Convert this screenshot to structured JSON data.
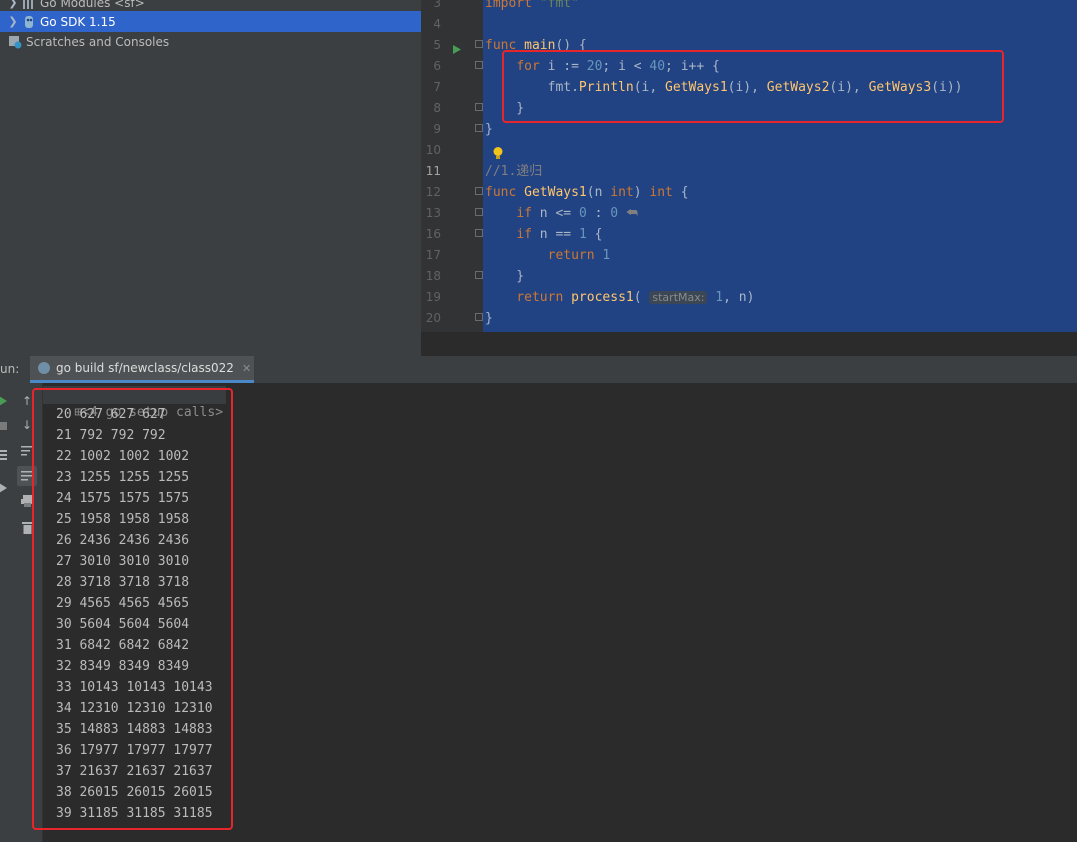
{
  "project_tree": {
    "items": [
      {
        "label": "Go Modules <sf>",
        "icon": "library-icon"
      },
      {
        "label": "Go SDK 1.15",
        "icon": "go-sdk-icon"
      },
      {
        "label": "Scratches and Consoles",
        "icon": "scratches-icon"
      }
    ]
  },
  "editor": {
    "line_numbers": [
      "3",
      "4",
      "5",
      "6",
      "7",
      "8",
      "9",
      "10",
      "11",
      "12",
      "13",
      "16",
      "17",
      "18",
      "19",
      "20"
    ],
    "current_line": "11",
    "param_hint": "startMax:"
  },
  "run": {
    "label": "un:",
    "tab_label": "go build sf/newclass/class022",
    "setup_calls": "<4 go setup calls>",
    "output": [
      "20 627 627 627",
      "21 792 792 792",
      "22 1002 1002 1002",
      "23 1255 1255 1255",
      "24 1575 1575 1575",
      "25 1958 1958 1958",
      "26 2436 2436 2436",
      "27 3010 3010 3010",
      "28 3718 3718 3718",
      "29 4565 4565 4565",
      "30 5604 5604 5604",
      "31 6842 6842 6842",
      "32 8349 8349 8349",
      "33 10143 10143 10143",
      "34 12310 12310 12310",
      "35 14883 14883 14883",
      "36 17977 17977 17977",
      "37 21637 21637 21637",
      "38 26015 26015 26015",
      "39 31185 31185 31185"
    ]
  },
  "colors": {
    "selection": "#214283",
    "highlight_box": "#e8252b",
    "keyword": "#cc7832",
    "function": "#ffc66d",
    "number": "#6897bb"
  }
}
